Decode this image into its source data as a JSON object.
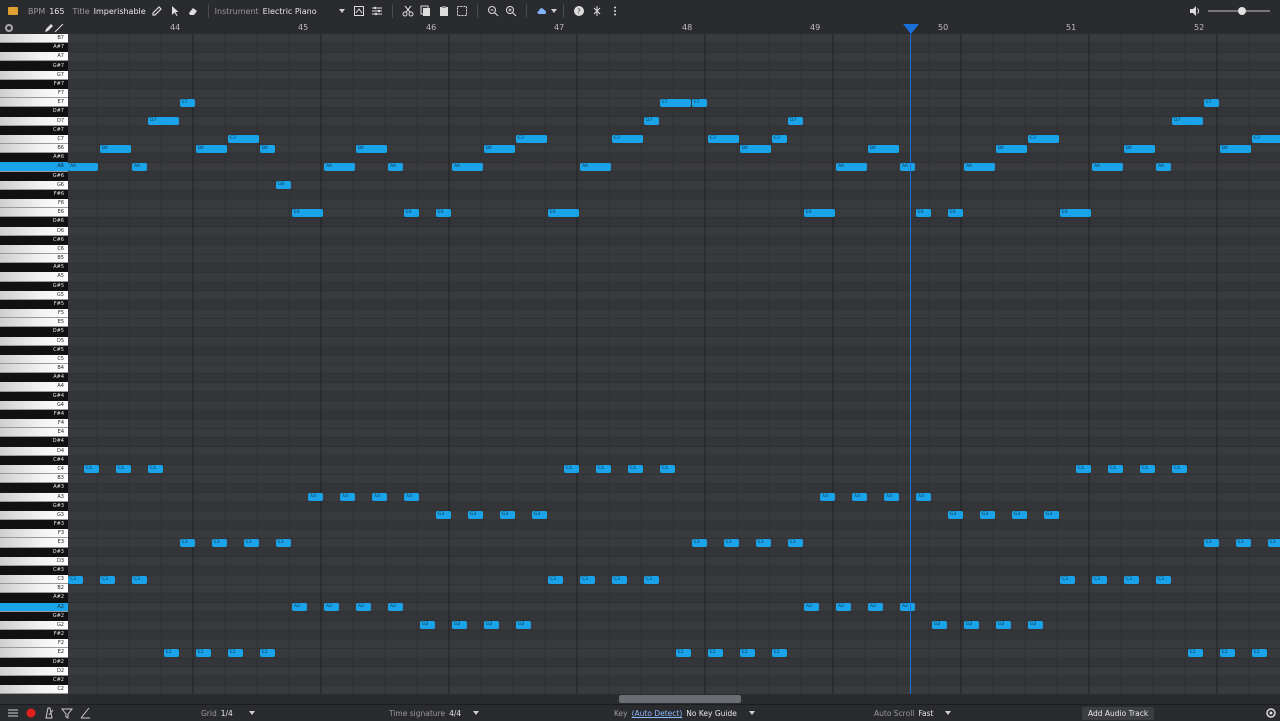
{
  "toolbar": {
    "bpm_label": "BPM",
    "bpm_value": "165",
    "title_label": "Title",
    "title_value": "Imperishable Vo",
    "instrument_label": "Instrument",
    "instrument_value": "Electric Piano"
  },
  "ruler": {
    "bars": [
      "44",
      "45",
      "46",
      "47",
      "48",
      "49",
      "50",
      "51",
      "52"
    ]
  },
  "keys": [
    "B7",
    "A#7",
    "A7",
    "G#7",
    "G7",
    "F#7",
    "F7",
    "E7",
    "D#7",
    "D7",
    "C#7",
    "C7",
    "B6",
    "A#6",
    "A6",
    "G#6",
    "G6",
    "F#6",
    "F6",
    "E6",
    "D#6",
    "D6",
    "C#6",
    "C6",
    "B5",
    "A#5",
    "A5",
    "G#5",
    "G5",
    "F#5",
    "F5",
    "E5",
    "D#5",
    "D5",
    "C#5",
    "C5",
    "B4",
    "A#4",
    "A4",
    "G#4",
    "G4",
    "F#4",
    "F4",
    "E4",
    "D#4",
    "D4",
    "C#4",
    "C4",
    "B3",
    "A#3",
    "A3",
    "G#3",
    "G3",
    "F#3",
    "F3",
    "E3",
    "D#3",
    "D3",
    "C#3",
    "C3",
    "B2",
    "A#2",
    "A2",
    "G#2",
    "G2",
    "F#2",
    "F2",
    "E2",
    "D#2",
    "D2",
    "C#2",
    "C2"
  ],
  "selected_keys": [
    "A6",
    "A2"
  ],
  "notes": [
    [
      "A6",
      0,
      30
    ],
    [
      "B6",
      32,
      31
    ],
    [
      "A6",
      64,
      15
    ],
    [
      "D7",
      80,
      31
    ],
    [
      "E7",
      112,
      15
    ],
    [
      "B6",
      128,
      31
    ],
    [
      "C7",
      160,
      31
    ],
    [
      "B6",
      192,
      15
    ],
    [
      "G6",
      208,
      15
    ],
    [
      "E6",
      224,
      31
    ],
    [
      "A6",
      256,
      31
    ],
    [
      "B6",
      288,
      31
    ],
    [
      "A6",
      320,
      15
    ],
    [
      "E6",
      336,
      15
    ],
    [
      "A6",
      384,
      31
    ],
    [
      "E6",
      368,
      15
    ],
    [
      "B6",
      416,
      31
    ],
    [
      "C7",
      448,
      31
    ],
    [
      "E6",
      480,
      31
    ],
    [
      "A6",
      512,
      31
    ],
    [
      "C7",
      544,
      31
    ],
    [
      "D7",
      576,
      15
    ],
    [
      "E7",
      592,
      31
    ],
    [
      "E7",
      624,
      15
    ],
    [
      "C7",
      640,
      31
    ],
    [
      "B6",
      672,
      31
    ],
    [
      "C7",
      704,
      15
    ],
    [
      "D7",
      720,
      15
    ],
    [
      "A6",
      768,
      31
    ],
    [
      "E6",
      736,
      31
    ],
    [
      "B6",
      800,
      31
    ],
    [
      "A6",
      832,
      15
    ],
    [
      "E6",
      848,
      15
    ],
    [
      "E6",
      880,
      15
    ],
    [
      "A6",
      896,
      31
    ],
    [
      "B6",
      928,
      31
    ],
    [
      "C7",
      960,
      31
    ],
    [
      "E6",
      992,
      31
    ],
    [
      "A6",
      1024,
      31
    ],
    [
      "B6",
      1056,
      31
    ],
    [
      "A6",
      1088,
      15
    ],
    [
      "D7",
      1104,
      31
    ],
    [
      "E7",
      1136,
      15
    ],
    [
      "B6",
      1152,
      31
    ],
    [
      "C7",
      1184,
      31
    ],
    [
      "C4",
      16,
      15
    ],
    [
      "C4",
      48,
      15
    ],
    [
      "C4",
      80,
      15
    ],
    [
      "C3",
      0,
      15
    ],
    [
      "C3",
      32,
      15
    ],
    [
      "C3",
      64,
      15
    ],
    [
      "E2",
      96,
      15
    ],
    [
      "E2",
      128,
      15
    ],
    [
      "E2",
      160,
      15
    ],
    [
      "E2",
      192,
      15
    ],
    [
      "E3",
      112,
      15
    ],
    [
      "E3",
      144,
      15
    ],
    [
      "E3",
      176,
      15
    ],
    [
      "E3",
      208,
      15
    ],
    [
      "A2",
      224,
      15
    ],
    [
      "A2",
      256,
      15
    ],
    [
      "A2",
      288,
      15
    ],
    [
      "A2",
      320,
      15
    ],
    [
      "A3",
      240,
      15
    ],
    [
      "A3",
      272,
      15
    ],
    [
      "A3",
      304,
      15
    ],
    [
      "A3",
      336,
      15
    ],
    [
      "G2",
      352,
      15
    ],
    [
      "G2",
      384,
      15
    ],
    [
      "G2",
      416,
      15
    ],
    [
      "G2",
      448,
      15
    ],
    [
      "G3",
      368,
      15
    ],
    [
      "G3",
      400,
      15
    ],
    [
      "G3",
      432,
      15
    ],
    [
      "G3",
      464,
      15
    ],
    [
      "C3",
      480,
      15
    ],
    [
      "C3",
      512,
      15
    ],
    [
      "C3",
      544,
      15
    ],
    [
      "C3",
      576,
      15
    ],
    [
      "C4",
      496,
      15
    ],
    [
      "C4",
      528,
      15
    ],
    [
      "C4",
      560,
      15
    ],
    [
      "C4",
      592,
      15
    ],
    [
      "E2",
      608,
      15
    ],
    [
      "E2",
      640,
      15
    ],
    [
      "E2",
      672,
      15
    ],
    [
      "E2",
      704,
      15
    ],
    [
      "E3",
      624,
      15
    ],
    [
      "E3",
      656,
      15
    ],
    [
      "E3",
      688,
      15
    ],
    [
      "E3",
      720,
      15
    ],
    [
      "A2",
      736,
      15
    ],
    [
      "A2",
      768,
      15
    ],
    [
      "A2",
      800,
      15
    ],
    [
      "A2",
      832,
      15
    ],
    [
      "A3",
      752,
      15
    ],
    [
      "A3",
      784,
      15
    ],
    [
      "A3",
      816,
      15
    ],
    [
      "A3",
      848,
      15
    ],
    [
      "G2",
      864,
      15
    ],
    [
      "G2",
      896,
      15
    ],
    [
      "G2",
      928,
      15
    ],
    [
      "G2",
      960,
      15
    ],
    [
      "G3",
      880,
      15
    ],
    [
      "G3",
      912,
      15
    ],
    [
      "G3",
      944,
      15
    ],
    [
      "G3",
      976,
      15
    ],
    [
      "C3",
      992,
      15
    ],
    [
      "C3",
      1024,
      15
    ],
    [
      "C3",
      1056,
      15
    ],
    [
      "C3",
      1088,
      15
    ],
    [
      "C4",
      1008,
      15
    ],
    [
      "C4",
      1040,
      15
    ],
    [
      "C4",
      1072,
      15
    ],
    [
      "C4",
      1104,
      15
    ],
    [
      "E2",
      1120,
      15
    ],
    [
      "E2",
      1152,
      15
    ],
    [
      "E2",
      1184,
      15
    ],
    [
      "E3",
      1136,
      15
    ],
    [
      "E3",
      1168,
      15
    ],
    [
      "E3",
      1200,
      15
    ]
  ],
  "status": {
    "grid_label": "Grid",
    "grid_value": "1/4",
    "timesig_label": "Time signature",
    "timesig_value": "4/4",
    "key_label": "Key",
    "key_auto": "(Auto Detect)",
    "key_value": "No Key Guide",
    "autoscroll_label": "Auto Scroll",
    "autoscroll_value": "Fast",
    "add_track": "Add Audio Track"
  },
  "colors": {
    "note": "#1aa3e8",
    "playhead": "#1b6fd8"
  }
}
